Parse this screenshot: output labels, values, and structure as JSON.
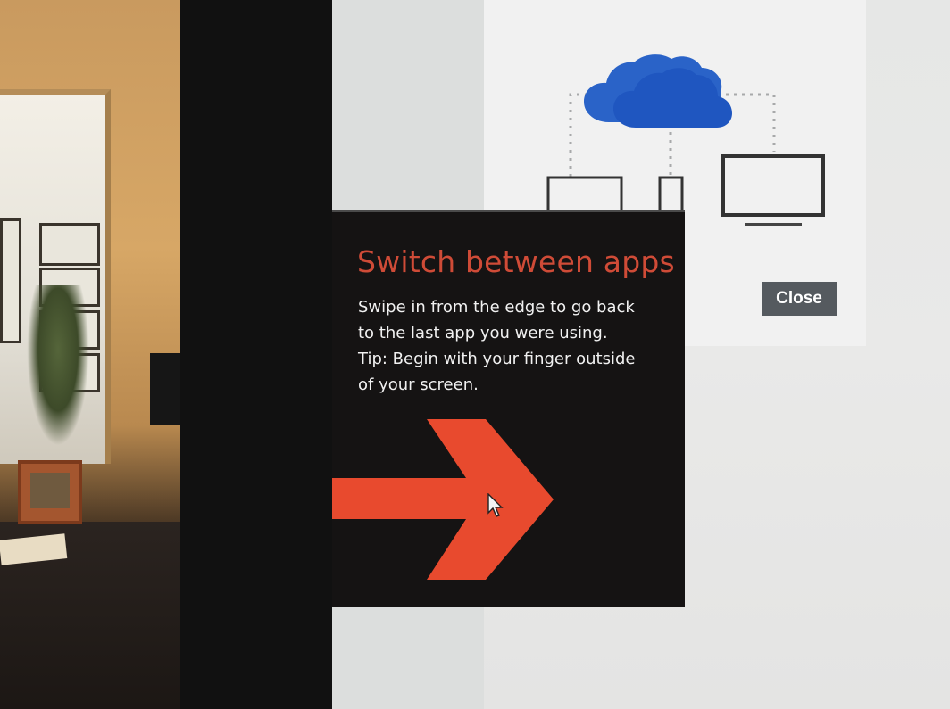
{
  "tip": {
    "title": "Switch between apps",
    "lines": [
      "Swipe in from the edge to go back",
      "to the last app you were using.",
      "Tip: Begin with your finger outside",
      "of your screen."
    ]
  },
  "promo": {
    "close_label": "Close"
  },
  "colors": {
    "accent_red": "#e84a2e",
    "title_red": "#cf4b37",
    "cloud_blue": "#1f58c2",
    "panel_bg": "#151313",
    "close_bg": "#555a5f"
  },
  "icons": [
    "cloud-icon",
    "laptop-icon",
    "phone-icon",
    "monitor-icon",
    "swipe-arrow-icon",
    "mouse-cursor-icon"
  ]
}
